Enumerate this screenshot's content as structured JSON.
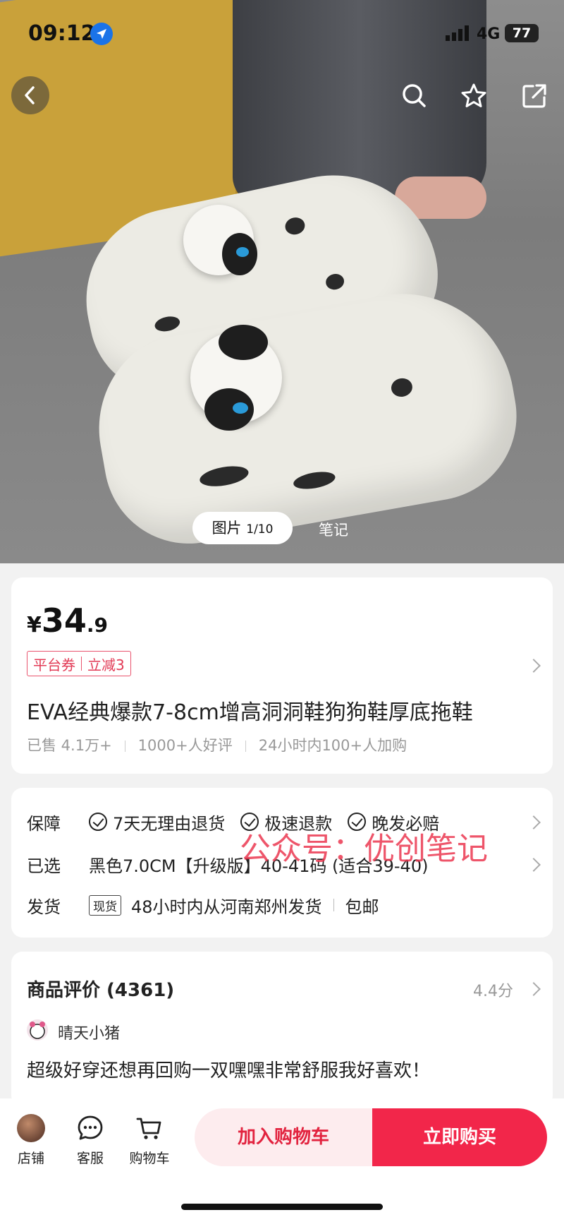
{
  "status_bar": {
    "time": "09:12",
    "network": "4G",
    "battery": "77"
  },
  "gallery": {
    "tab_images_label": "图片",
    "tab_images_count": "1/10",
    "tab_notes_label": "笔记"
  },
  "product": {
    "currency": "¥",
    "price_int": "34",
    "price_dec": ".9",
    "coupon_type": "平台券",
    "coupon_value": "立减3",
    "title": "EVA经典爆款7-8cm增高洞洞鞋狗狗鞋厚底拖鞋",
    "sold": "已售 4.1万+",
    "good_reviews": "1000+人好评",
    "recent_buys": "24小时内100+人加购"
  },
  "service": {
    "guarantee_label": "保障",
    "guarantees": [
      "7天无理由退货",
      "极速退款",
      "晚发必赔"
    ],
    "selected_label": "已选",
    "selected_value": "黑色7.0CM【升级版】40-41码 (适合39-40)",
    "shipping_label": "发货",
    "stock_tag": "现货",
    "shipping_value": "48小时内从河南郑州发货",
    "postage": "包邮"
  },
  "watermark": "公众号：优创笔记",
  "reviews": {
    "title": "商品评价 (4361)",
    "score": "4.4分",
    "user": "晴天小猪",
    "text": "超级好穿还想再回购一双嘿嘿非常舒服我好喜欢！"
  },
  "bottom_bar": {
    "shop": "店铺",
    "service": "客服",
    "cart": "购物车",
    "add_to_cart": "加入购物车",
    "buy_now": "立即购买"
  },
  "colors": {
    "accent": "#f2264a",
    "accent_light": "#fdecee",
    "coupon": "#e23a55"
  }
}
